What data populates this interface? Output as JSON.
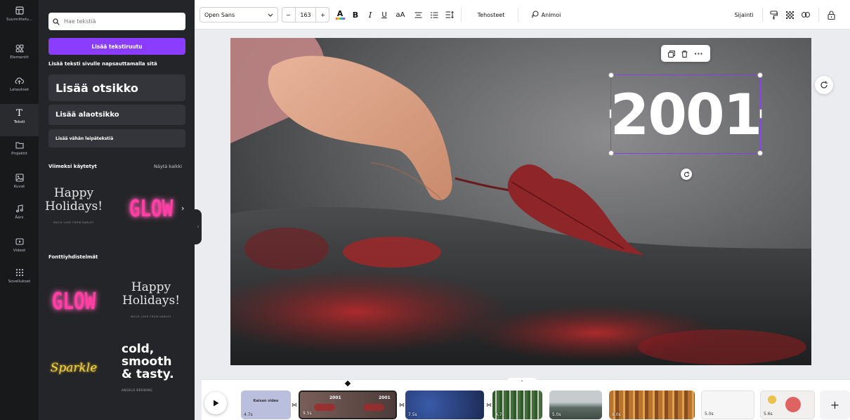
{
  "rail": [
    {
      "label": "Suunnittelu...",
      "icon": "template-icon",
      "active": false
    },
    {
      "label": "Elementit",
      "icon": "shapes-icon",
      "active": false
    },
    {
      "label": "Lataukset",
      "icon": "upload-icon",
      "active": false
    },
    {
      "label": "Teksti",
      "icon": "text-icon",
      "active": true
    },
    {
      "label": "Projektit",
      "icon": "folder-icon",
      "active": false
    },
    {
      "label": "Kuvat",
      "icon": "image-icon",
      "active": false
    },
    {
      "label": "Ääni",
      "icon": "music-icon",
      "active": false
    },
    {
      "label": "Videot",
      "icon": "video-icon",
      "active": false
    },
    {
      "label": "Sovellukset",
      "icon": "apps-icon",
      "active": false
    }
  ],
  "panel": {
    "search_placeholder": "Hae tekstiä",
    "add_textbox": "Lisää tekstiruutu",
    "hint": "Lisää teksti sivulle napsauttamalla sitä",
    "heading": "Lisää otsikko",
    "subheading": "Lisää alaotsikko",
    "body": "Lisää vähän leipätekstiä",
    "recent_title": "Viimeksi käytetyt",
    "show_all": "Näytä kaikki",
    "combos_title": "Fonttiyhdistelmät",
    "happy_line1": "Happy",
    "happy_line2": "Holidays!",
    "happy_small": "MUCH LOVE FROM HARLEY",
    "glow": "GLOW",
    "sparkle": "Sparkle",
    "cold_l1": "cold,",
    "cold_l2": "smooth",
    "cold_l3": "& tasty.",
    "cold_small": "ANGELO BREWING"
  },
  "toolbar": {
    "font": "Open Sans",
    "size": "163",
    "minus": "−",
    "plus": "+",
    "aa": "aA",
    "effects": "Tehosteet",
    "animate": "Animoi",
    "position": "Sijainti"
  },
  "canvas": {
    "year": "2001"
  },
  "timeline": {
    "clips": [
      {
        "label": "Kaisan video",
        "dur": "4.7s",
        "bg": "#b9bfdc"
      },
      {
        "label": "2001",
        "dur": "9.5s",
        "bg": "#5a4a46"
      },
      {
        "label": "",
        "dur": "7.5s",
        "bg": "#4a6ab0"
      },
      {
        "label": "",
        "dur": "4.7s",
        "bg": "#3f6a3a"
      },
      {
        "label": "",
        "dur": "5.0s",
        "bg": "#6b7470"
      },
      {
        "label": "",
        "dur": "8.0s",
        "bg": "#b8742c"
      },
      {
        "label": "",
        "dur": "5.0s",
        "bg": "#f6f6f6"
      },
      {
        "label": "",
        "dur": "5.6s",
        "bg": "#f2f0ee"
      }
    ],
    "add": "+"
  },
  "colors": {
    "accent": "#8b3dff",
    "rail": "#18191b",
    "panel": "#242528"
  }
}
